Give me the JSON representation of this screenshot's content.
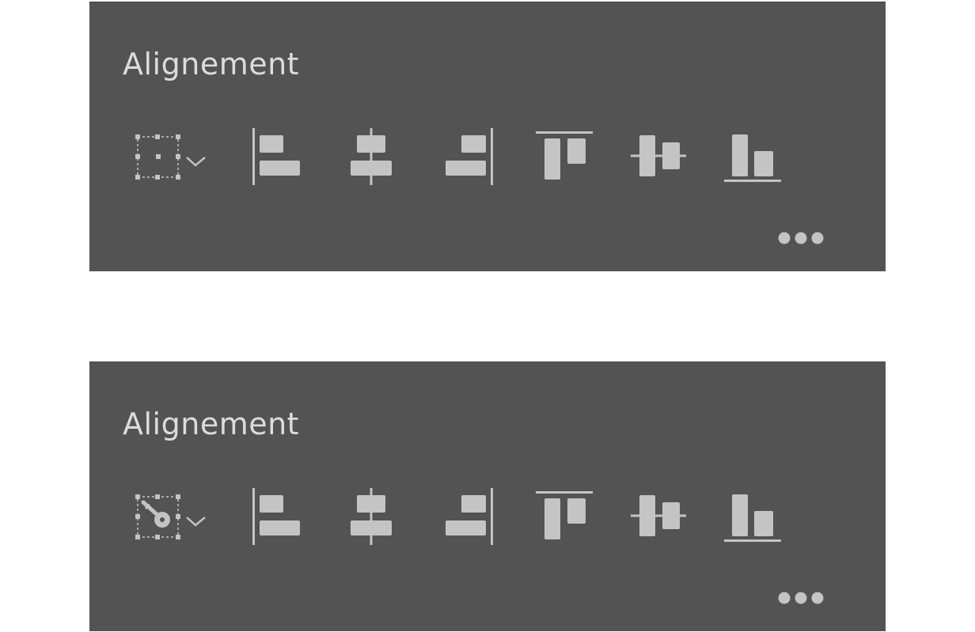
{
  "panels": [
    {
      "title": "Alignement",
      "align_to_variant": "selection",
      "align_to_icon": "align-to-selection-icon",
      "more_icon": "more-options-icon"
    },
    {
      "title": "Alignement",
      "align_to_variant": "key-object",
      "align_to_icon": "align-to-key-object-icon",
      "more_icon": "more-options-icon"
    }
  ],
  "tools": [
    {
      "name": "align-left-edges",
      "icon": "align-left-edges-icon"
    },
    {
      "name": "align-horizontal-centers",
      "icon": "align-horizontal-centers-icon"
    },
    {
      "name": "align-right-edges",
      "icon": "align-right-edges-icon"
    },
    {
      "name": "align-top-edges",
      "icon": "align-top-edges-icon"
    },
    {
      "name": "align-vertical-centers",
      "icon": "align-vertical-centers-icon"
    },
    {
      "name": "align-bottom-edges",
      "icon": "align-bottom-edges-icon"
    }
  ],
  "colors": {
    "panel_bg": "#535353",
    "icon": "#c4c4c4",
    "title": "#dcdcdc",
    "page_bg": "#ffffff"
  }
}
